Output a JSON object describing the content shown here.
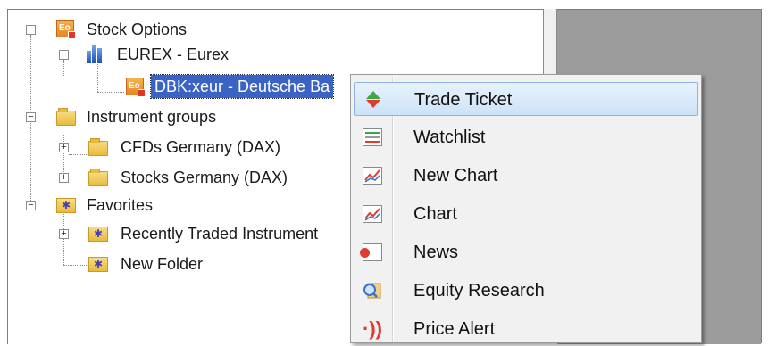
{
  "tree": {
    "nodes": [
      {
        "label": "Stock Options"
      },
      {
        "label": "EUREX - Eurex"
      },
      {
        "label": "DBK:xeur - Deutsche Ba"
      },
      {
        "label": "Instrument groups"
      },
      {
        "label": "CFDs Germany (DAX)"
      },
      {
        "label": "Stocks Germany (DAX)"
      },
      {
        "label": "Favorites"
      },
      {
        "label": "Recently Traded Instrument"
      },
      {
        "label": "New Folder"
      }
    ],
    "expand_symbol": "+",
    "collapse_symbol": "−"
  },
  "icons": {
    "option": "Eo",
    "favorite": "✱",
    "alert": "·))"
  },
  "context_menu": {
    "items": [
      {
        "label": "Trade Ticket",
        "icon": "trade-ticket-icon"
      },
      {
        "label": "Watchlist",
        "icon": "watchlist-icon"
      },
      {
        "label": "New Chart",
        "icon": "new-chart-icon"
      },
      {
        "label": "Chart",
        "icon": "chart-icon"
      },
      {
        "label": "News",
        "icon": "news-icon"
      },
      {
        "label": "Equity Research",
        "icon": "equity-research-icon"
      },
      {
        "label": "Price Alert",
        "icon": "price-alert-icon"
      }
    ]
  },
  "colors": {
    "selection": "#3b63c4",
    "menu_hover": "#cde3f8",
    "right_pane": "#9c9c9c"
  }
}
